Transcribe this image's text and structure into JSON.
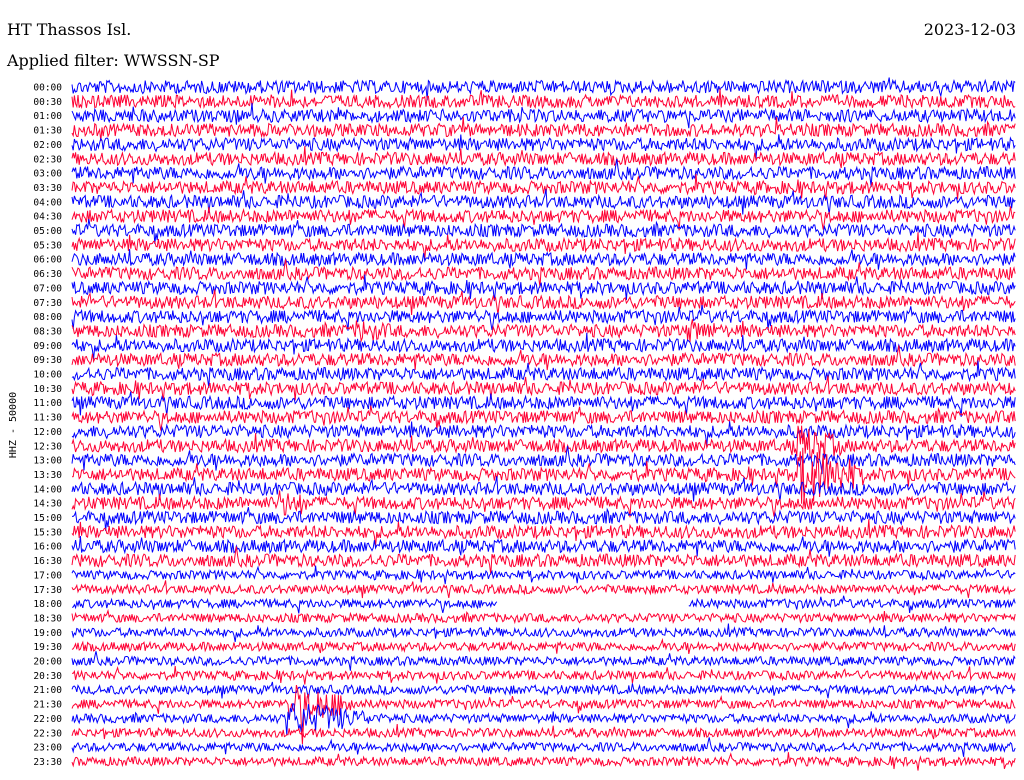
{
  "header": {
    "station": "HT Thassos Isl.",
    "date": "2023-12-03",
    "filter": "Applied filter: WWSSN-SP"
  },
  "chart_data": {
    "type": "seismogram",
    "ylabel": "HHZ - 50000",
    "row_labels": [
      "00:00",
      "00:30",
      "01:00",
      "01:30",
      "02:00",
      "02:30",
      "03:00",
      "03:30",
      "04:00",
      "04:30",
      "05:00",
      "05:30",
      "06:00",
      "06:30",
      "07:00",
      "07:30",
      "08:00",
      "08:30",
      "09:00",
      "09:30",
      "10:00",
      "10:30",
      "11:00",
      "11:30",
      "12:00",
      "12:30",
      "13:00",
      "13:30",
      "14:00",
      "14:30",
      "15:00",
      "15:30",
      "16:00",
      "16:30",
      "17:00",
      "17:30",
      "18:00",
      "18:30",
      "19:00",
      "19:30",
      "20:00",
      "20:30",
      "21:00",
      "21:30",
      "22:00",
      "22:30",
      "23:00",
      "23:30"
    ],
    "row_interval_minutes": 30,
    "x_range_minutes": [
      0,
      30
    ],
    "trace_colors": [
      "#0000ff",
      "#ff0033"
    ],
    "color_pattern": "alternating by row",
    "events": [
      {
        "row": "08:30",
        "minute_start": 9.0,
        "minute_end": 10.5,
        "relative_amplitude": 2.0
      },
      {
        "row": "08:30",
        "minute_start": 19.5,
        "minute_end": 21.0,
        "relative_amplitude": 2.0
      },
      {
        "row": "12:30",
        "minute_start": 23.0,
        "minute_end": 24.5,
        "relative_amplitude": 3.5
      },
      {
        "row": "13:30",
        "minute_start": 23.0,
        "minute_end": 25.0,
        "relative_amplitude": 5.0
      },
      {
        "row": "14:30",
        "minute_start": 6.5,
        "minute_end": 7.5,
        "relative_amplitude": 2.5
      },
      {
        "row": "21:30",
        "minute_start": 6.8,
        "minute_end": 9.0,
        "relative_amplitude": 5.0
      },
      {
        "row": "22:00",
        "minute_start": 6.8,
        "minute_end": 9.5,
        "relative_amplitude": 4.0
      }
    ],
    "data_gaps": [
      {
        "row": "18:00",
        "minute_start": 13.5,
        "minute_end": 19.6
      }
    ]
  }
}
